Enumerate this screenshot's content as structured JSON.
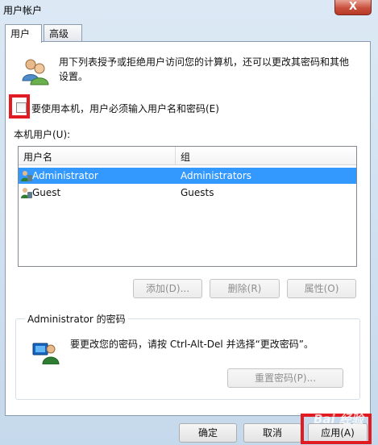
{
  "window": {
    "title": "用户帐户",
    "close_label": "X"
  },
  "tabs": [
    {
      "label": "用户"
    },
    {
      "label": "高级"
    }
  ],
  "intro_text": "用下列表授予或拒绝用户访问您的计算机，还可以更改其密码和其他设置。",
  "checkbox": {
    "label": "要使用本机，用户必须输入用户名和密码(E)",
    "checked": false
  },
  "users_list": {
    "label": "本机用户(U):",
    "columns": [
      "用户名",
      "组"
    ],
    "rows": [
      {
        "name": "Administrator",
        "group": "Administrators",
        "selected": true
      },
      {
        "name": "Guest",
        "group": "Guests",
        "selected": false
      }
    ]
  },
  "list_buttons": {
    "add": "添加(D)...",
    "remove": "删除(R)",
    "properties": "属性(O)"
  },
  "password_group": {
    "title": "Administrator 的密码",
    "text": "要更改您的密码，请按 Ctrl-Alt-Del 并选择“更改密码”。",
    "reset_button": "重置密码(P)..."
  },
  "footer": {
    "ok": "确定",
    "cancel": "取消",
    "apply": "应用(A)"
  },
  "watermark": "Bai 经验",
  "colors": {
    "selection": "#3399ff",
    "highlight_box": "#e21b23",
    "close_button": "#c9503d"
  }
}
